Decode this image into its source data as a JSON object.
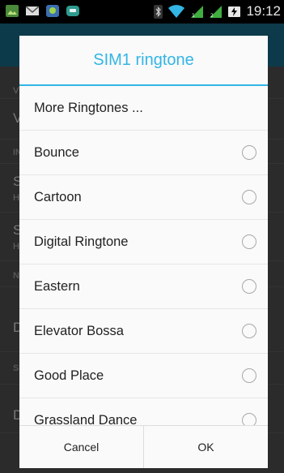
{
  "status_bar": {
    "time": "19:12",
    "left_icons": [
      "gallery-icon",
      "email-icon",
      "android-icon",
      "chat-icon"
    ],
    "right_icons": [
      "bluetooth-icon",
      "wifi-icon",
      "signal-sim1-icon",
      "signal-sim2-icon",
      "battery-charging-icon"
    ]
  },
  "background": {
    "row_letters": [
      "V",
      "V",
      "IN",
      "S",
      "H",
      "S",
      "H",
      "N",
      "D",
      "S",
      "D"
    ]
  },
  "dialog": {
    "title": "SIM1 ringtone",
    "items": [
      {
        "label": "More Ringtones ...",
        "has_radio": false
      },
      {
        "label": "Bounce",
        "has_radio": true
      },
      {
        "label": "Cartoon",
        "has_radio": true
      },
      {
        "label": "Digital Ringtone",
        "has_radio": true
      },
      {
        "label": "Eastern",
        "has_radio": true
      },
      {
        "label": "Elevator Bossa",
        "has_radio": true
      },
      {
        "label": "Good Place",
        "has_radio": true
      },
      {
        "label": "Grassland Dance",
        "has_radio": true
      }
    ],
    "cancel_label": "Cancel",
    "ok_label": "OK"
  },
  "colors": {
    "accent": "#33b5e5",
    "dialog_bg": "#fafafa",
    "status_bar_bg": "#000000"
  }
}
